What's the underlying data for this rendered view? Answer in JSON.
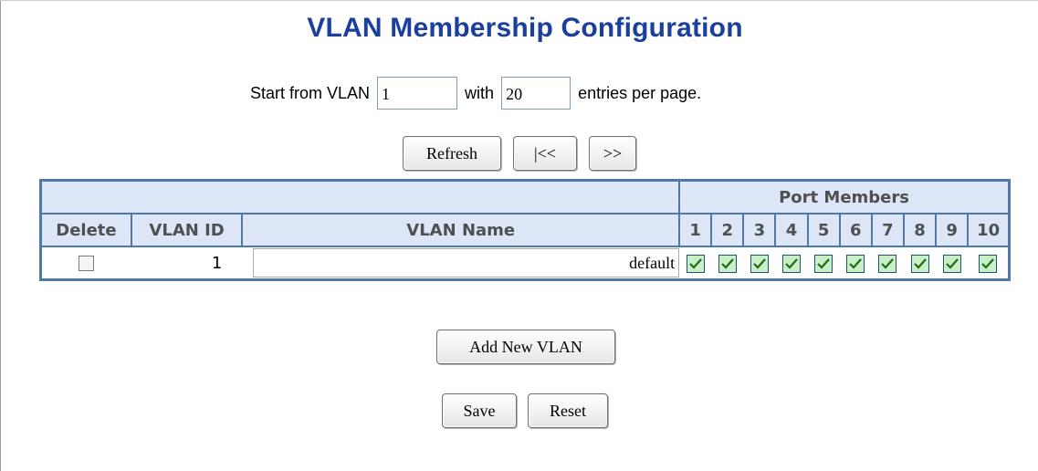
{
  "title": "VLAN Membership Configuration",
  "paging": {
    "start_label": "Start from VLAN",
    "start_value": "1",
    "with_label": "with",
    "with_value": "20",
    "entries_label": "entries per page."
  },
  "nav_buttons": {
    "refresh": "Refresh",
    "prev": "|<<",
    "next": ">>"
  },
  "table": {
    "group_header": "Port Members",
    "columns": {
      "delete": "Delete",
      "vlan_id": "VLAN ID",
      "vlan_name": "VLAN Name"
    },
    "ports": [
      "1",
      "2",
      "3",
      "4",
      "5",
      "6",
      "7",
      "8",
      "9",
      "10"
    ],
    "rows": [
      {
        "delete_checked": false,
        "vlan_id": "1",
        "vlan_name": "default",
        "members": [
          true,
          true,
          true,
          true,
          true,
          true,
          true,
          true,
          true,
          true
        ]
      }
    ]
  },
  "add_button": "Add New VLAN",
  "save_button": "Save",
  "reset_button": "Reset",
  "colors": {
    "title": "#1a3f9c",
    "table_border": "#4f79a8",
    "header_bg": "#dce6f7",
    "check_fill": "#c9f0c4",
    "check_mark": "#1f6b1a"
  }
}
